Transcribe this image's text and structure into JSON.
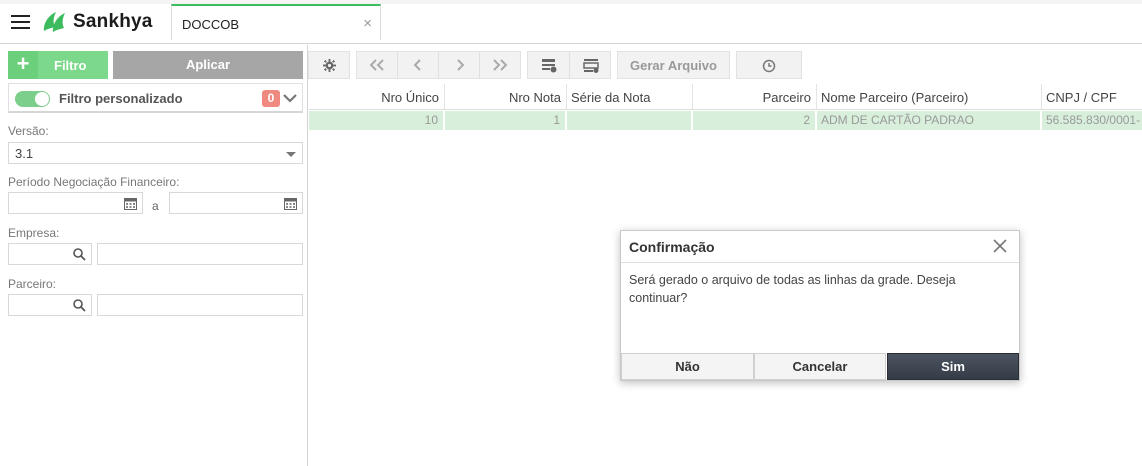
{
  "app": {
    "brand": "Sankhya",
    "tab_label": "DOCCOB",
    "tab_close": "×"
  },
  "filters": {
    "filtro_label": "Filtro",
    "filtro_plus": "+",
    "aplicar_label": "Aplicar",
    "filtro_personalizado_label": "Filtro personalizado",
    "filtro_personalizado_count": "0",
    "versao_label": "Versão:",
    "versao_value": "3.1",
    "periodo_label": "Período Negociação Financeiro:",
    "periodo_sep": "a",
    "empresa_label": "Empresa:",
    "parceiro_label": "Parceiro:"
  },
  "toolbar": {
    "gerar_arquivo_label": "Gerar Arquivo"
  },
  "grid": {
    "columns": [
      "Nro Único",
      "Nro Nota",
      "Série da Nota",
      "Parceiro",
      "Nome Parceiro (Parceiro)",
      "CNPJ / CPF"
    ],
    "rows": [
      [
        "10",
        "1",
        "",
        "2",
        "ADM DE CARTÃO PADRAO",
        "56.585.830/0001-"
      ]
    ]
  },
  "dialog": {
    "title": "Confirmação",
    "message": "Será gerado o arquivo de todas as linhas da grade. Deseja continuar?",
    "nao_label": "Não",
    "cancelar_label": "Cancelar",
    "sim_label": "Sim"
  },
  "colors": {
    "accent_green": "#3dbb5f",
    "row_selected": "#d8efdc",
    "badge": "#f08a80",
    "primary_button": "#3a414c"
  }
}
